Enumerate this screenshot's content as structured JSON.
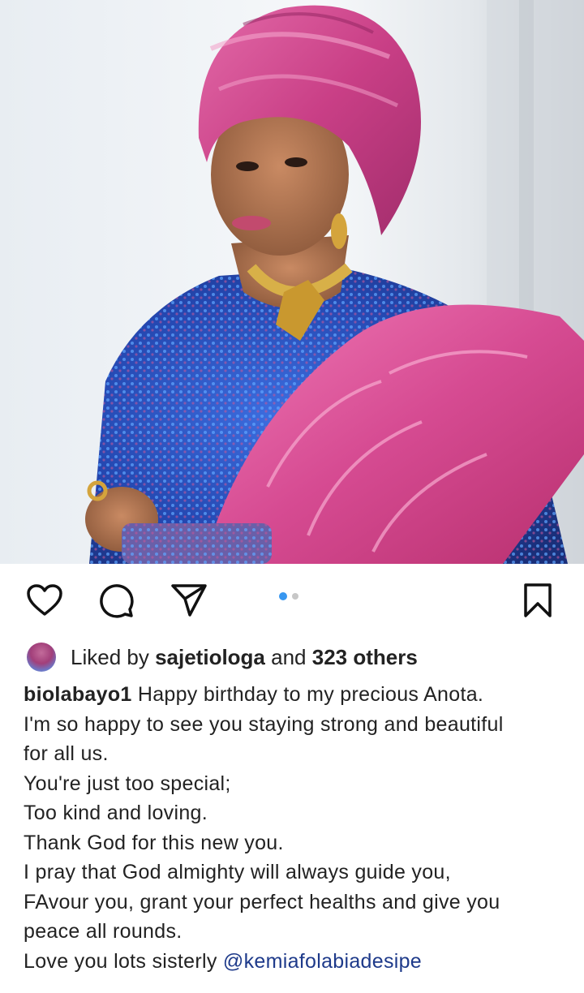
{
  "post": {
    "image_alt": "Portrait of a woman in a pink gele headwrap, blue sequined top, pink patterned sash and gold necklace",
    "carousel": {
      "count": 2,
      "active_index": 0
    }
  },
  "actions": {
    "like_icon": "heart-icon",
    "comment_icon": "comment-icon",
    "share_icon": "paper-plane-icon",
    "save_icon": "bookmark-icon"
  },
  "likes": {
    "prefix": "Liked by",
    "user": "sajetiologa",
    "middle": "and",
    "others": "323 others"
  },
  "caption": {
    "username": "biolabayo1",
    "line1": "Happy birthday to my precious Anota.",
    "line2": "I'm so happy to see you staying strong and beautiful",
    "line3": "for all us.",
    "line4": "You're just too special;",
    "line5": "Too kind and loving.",
    "line6": "Thank God for this new you.",
    "line7": "I pray that God almighty will always guide you,",
    "line8": "FAvour you, grant your perfect healths and give you",
    "line9": "peace all rounds.",
    "line10_prefix": "Love you lots sisterly",
    "mention": "@kemiafolabiadesipe"
  },
  "colors": {
    "accent_blue": "#3897f0",
    "mention_blue": "#1e3a8a",
    "gele_pink": "#d24a8c",
    "dress_blue": "#2e5bd0"
  }
}
